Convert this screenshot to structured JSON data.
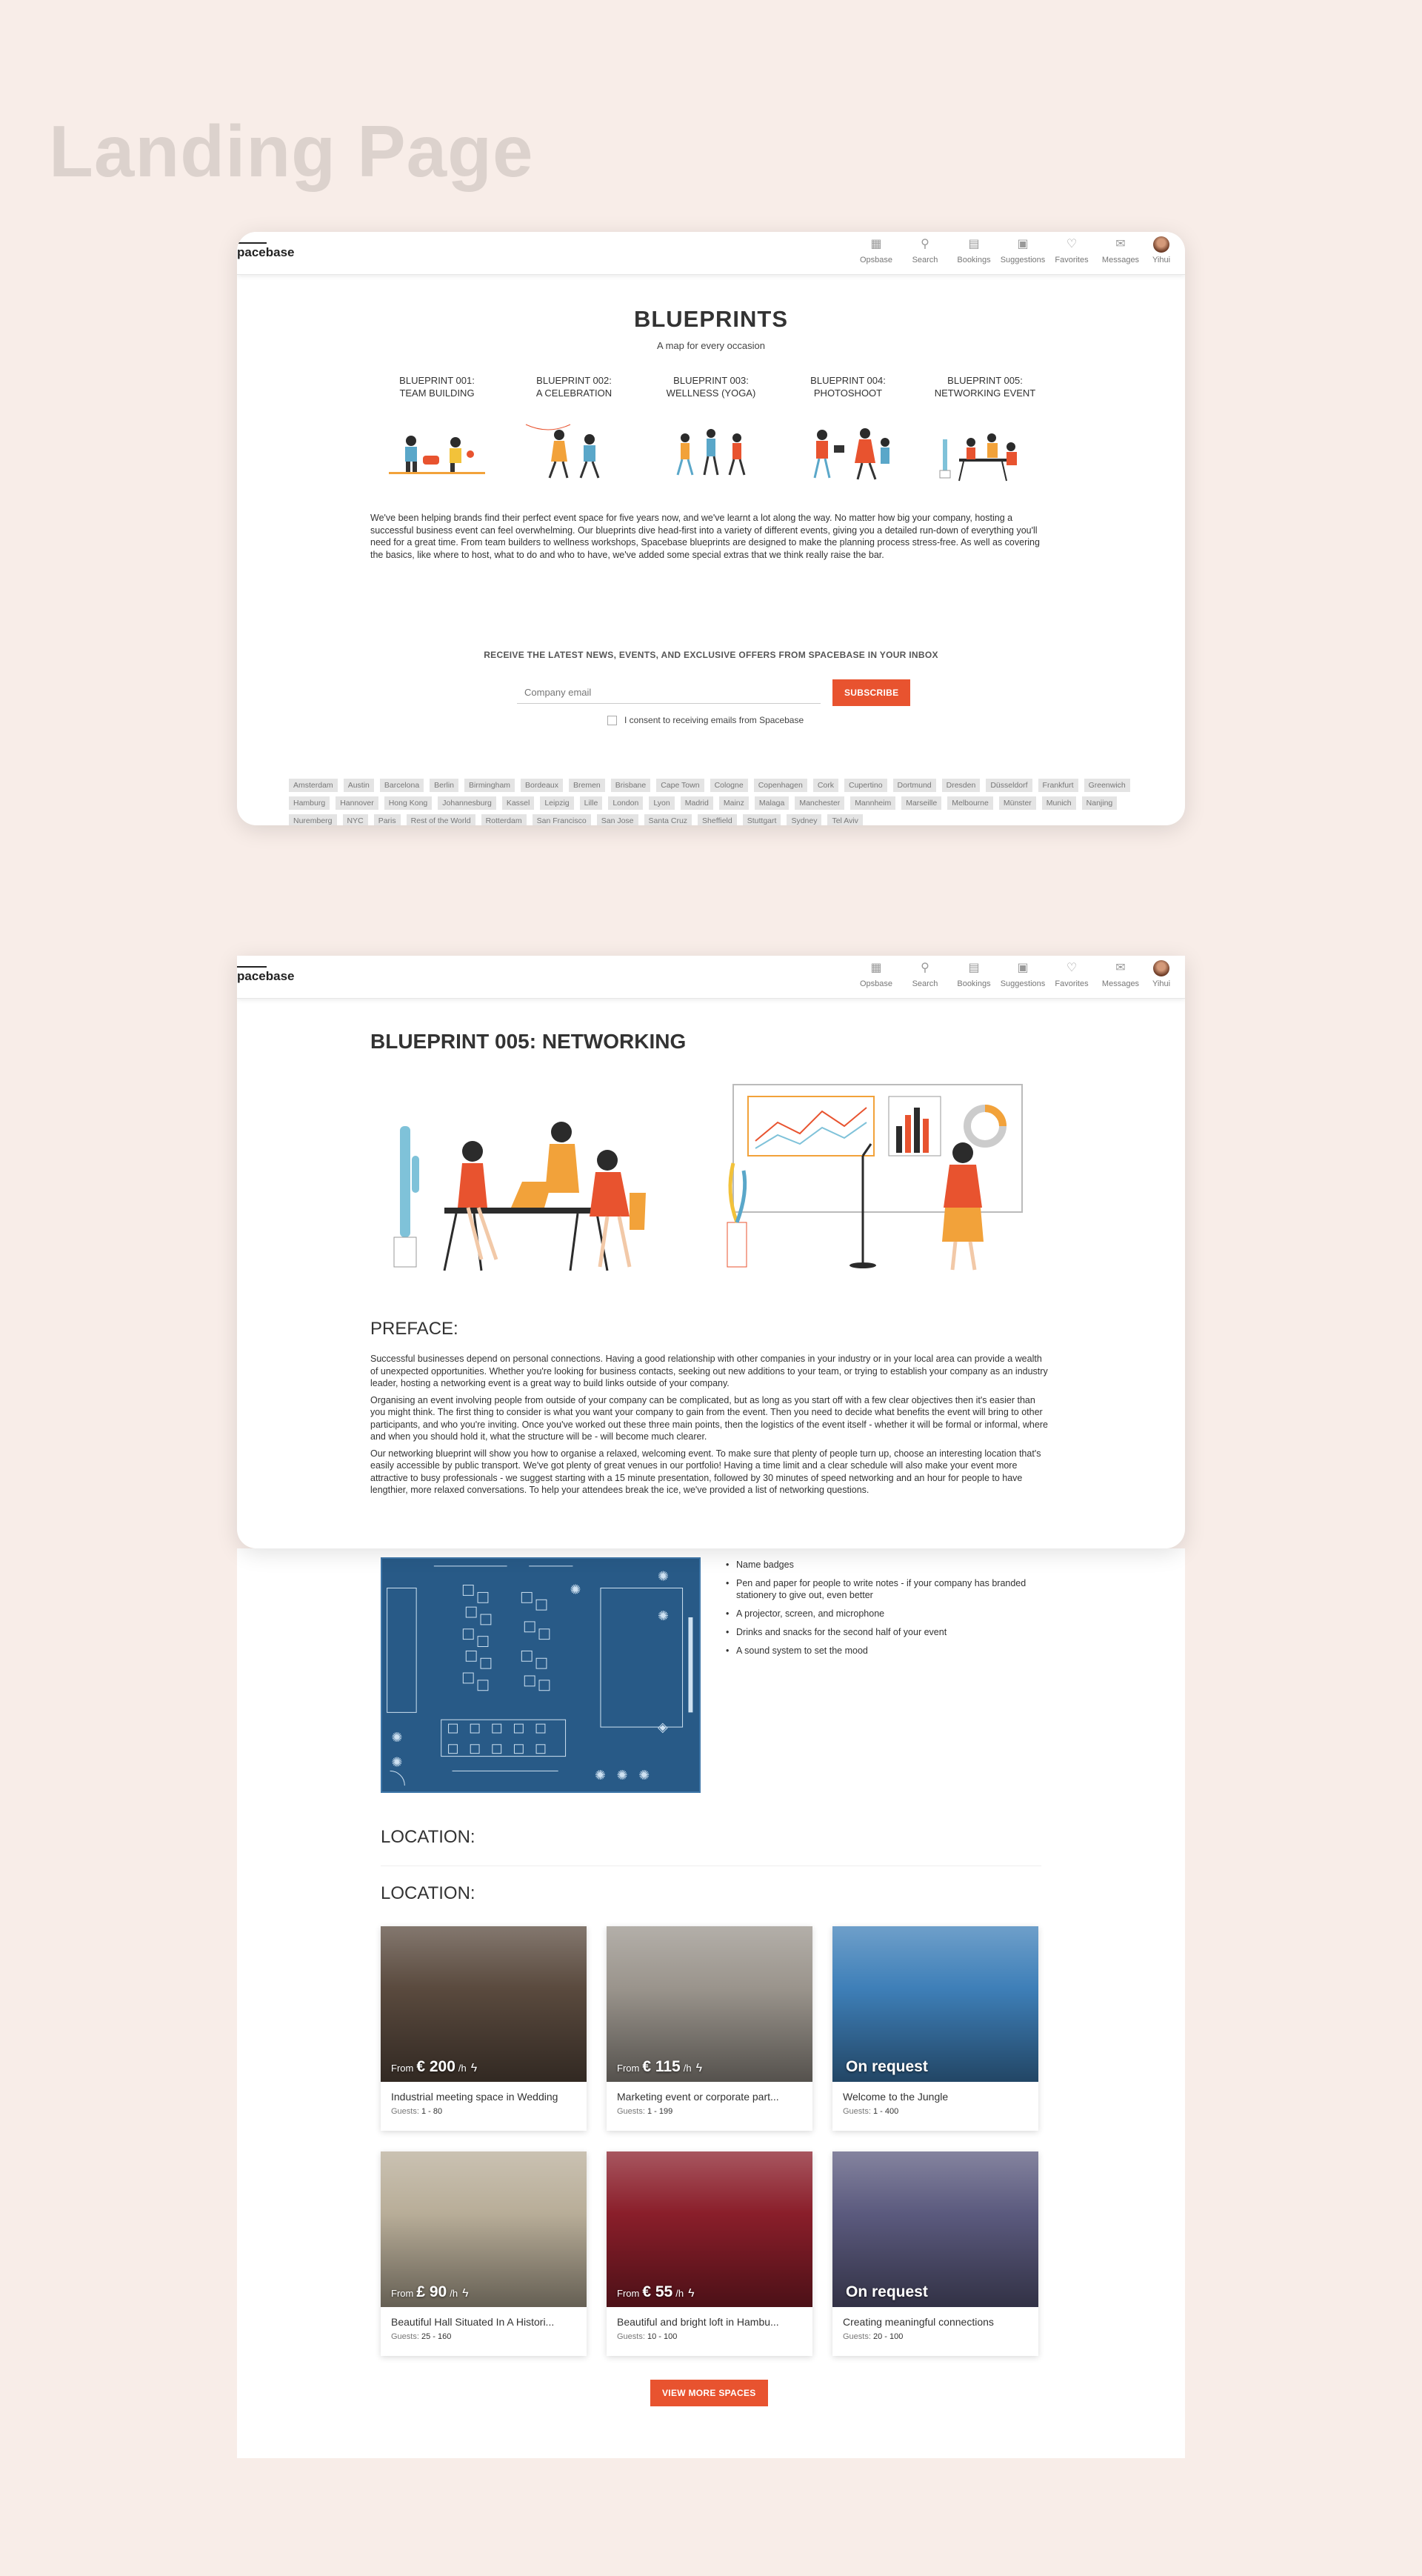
{
  "page_heading": "Landing Page",
  "nav": {
    "logo": "pacebase",
    "items": [
      {
        "label": "Opsbase",
        "icon": "dashboard-icon"
      },
      {
        "label": "Search",
        "icon": "search-icon"
      },
      {
        "label": "Bookings",
        "icon": "clipboard-icon"
      },
      {
        "label": "Suggestions",
        "icon": "suggestions-icon"
      },
      {
        "label": "Favorites",
        "icon": "heart-icon"
      },
      {
        "label": "Messages",
        "icon": "envelope-icon"
      }
    ],
    "user": "Yihui"
  },
  "blueprints": {
    "title": "BLUEPRINTS",
    "subtitle": "A map for every occasion",
    "items": [
      {
        "line1": "BLUEPRINT 001:",
        "line2": "TEAM BUILDING"
      },
      {
        "line1": "BLUEPRINT 002:",
        "line2": "A CELEBRATION"
      },
      {
        "line1": "BLUEPRINT 003:",
        "line2": "WELLNESS (YOGA)"
      },
      {
        "line1": "BLUEPRINT 004:",
        "line2": "PHOTOSHOOT"
      },
      {
        "line1": "BLUEPRINT 005:",
        "line2": "NETWORKING EVENT"
      }
    ],
    "intro": "We've been helping brands find their perfect event space for five years now, and we've learnt a lot along the way. No matter how big your company, hosting a successful business event can feel overwhelming. Our blueprints dive head-first into a variety of different events, giving you a detailed run-down of everything you'll need for a great time. From team builders to wellness workshops, Spacebase blueprints are designed to make the planning process stress-free. As well as covering the basics, like where to host, what to do and who to have, we've added some special extras that we think really raise the bar."
  },
  "newsletter": {
    "heading": "RECEIVE THE LATEST NEWS, EVENTS, AND EXCLUSIVE OFFERS FROM SPACEBASE IN YOUR INBOX",
    "placeholder": "Company email",
    "button": "SUBSCRIBE",
    "consent": "I consent to receiving emails from Spacebase"
  },
  "cities": [
    "Amsterdam",
    "Austin",
    "Barcelona",
    "Berlin",
    "Birmingham",
    "Bordeaux",
    "Bremen",
    "Brisbane",
    "Cape Town",
    "Cologne",
    "Copenhagen",
    "Cork",
    "Cupertino",
    "Dortmund",
    "Dresden",
    "Düsseldorf",
    "Frankfurt",
    "Greenwich",
    "Hamburg",
    "Hannover",
    "Hong Kong",
    "Johannesburg",
    "Kassel",
    "Leipzig",
    "Lille",
    "London",
    "Lyon",
    "Madrid",
    "Mainz",
    "Malaga",
    "Manchester",
    "Mannheim",
    "Marseille",
    "Melbourne",
    "Münster",
    "Munich",
    "Nanjing",
    "Nuremberg",
    "NYC",
    "Paris",
    "Rest of the World",
    "Rotterdam",
    "San Francisco",
    "San Jose",
    "Santa Cruz",
    "Sheffield",
    "Stuttgart",
    "Sydney",
    "Tel Aviv"
  ],
  "networking": {
    "title": "BLUEPRINT 005: NETWORKING",
    "preface_heading": "PREFACE:",
    "paragraphs": [
      "Successful businesses depend on personal connections. Having a good relationship with other companies in your industry or in your local area can provide a wealth of unexpected opportunities. Whether you're looking for business contacts, seeking out new additions to your team, or trying to establish your company as an industry leader, hosting a networking event is a great way to build links outside of your company.",
      "Organising an event involving people from outside of your company can be complicated, but as long as you start off with a few clear objectives then it's easier than you might think. The first thing to consider is what you want your company to gain from the event. Then you need to decide what benefits the event will bring to other participants, and who you're inviting. Once you've worked out these three main points, then the logistics of the event itself - whether it will be formal or informal, where and when you should hold it, what the structure will be - will become much clearer.",
      "Our networking blueprint will show you how to organise a relaxed, welcoming event. To make sure that plenty of people turn up, choose an interesting location that's easily accessible by public transport. We've got plenty of great venues in our portfolio! Having a time limit and a clear schedule will also make your event more attractive to busy professionals - we suggest starting with a 15 minute presentation, followed by 30 minutes of speed networking and an hour for people to have lengthier, more relaxed conversations. To help your attendees break the ice, we've provided a list of networking questions."
    ],
    "equipment": [
      "Name badges",
      "Pen and paper for people to write notes - if your company has branded stationery to give out, even better",
      "A projector, screen, and microphone",
      "Drinks and snacks for the second half of your event",
      "A sound system to set the mood"
    ],
    "location_heading_1": "LOCATION:",
    "location_heading_2": "LOCATION:"
  },
  "spaces": [
    {
      "price_prefix": "From",
      "price": "€ 200",
      "unit": "/h",
      "name": "Industrial meeting space in Wedding",
      "guests_label": "Guests:",
      "guests": "1 - 80",
      "tone": "#5a4a3e"
    },
    {
      "price_prefix": "From",
      "price": "€ 115",
      "unit": "/h",
      "name": "Marketing event or corporate part...",
      "guests_label": "Guests:",
      "guests": "1 - 199",
      "tone": "#9a948c"
    },
    {
      "price_prefix": "",
      "price": "On request",
      "unit": "",
      "name": "Welcome to the Jungle",
      "guests_label": "Guests:",
      "guests": "1 - 400",
      "tone": "#3e7fb8"
    },
    {
      "price_prefix": "From",
      "price": "£ 90",
      "unit": "/h",
      "name": "Beautiful Hall Situated In A Histori...",
      "guests_label": "Guests:",
      "guests": "25 - 160",
      "tone": "#b8ad98"
    },
    {
      "price_prefix": "From",
      "price": "€ 55",
      "unit": "/h",
      "name": "Beautiful and bright loft in Hambu...",
      "guests_label": "Guests:",
      "guests": "10 - 100",
      "tone": "#8a1e2a"
    },
    {
      "price_prefix": "",
      "price": "On request",
      "unit": "",
      "name": "Creating meaningful connections",
      "guests_label": "Guests:",
      "guests": "20 - 100",
      "tone": "#5b5a7e"
    }
  ],
  "view_more": "VIEW MORE SPACES",
  "colors": {
    "accent": "#e8532f",
    "background": "#f8ede8",
    "floorplan": "#285a87"
  }
}
